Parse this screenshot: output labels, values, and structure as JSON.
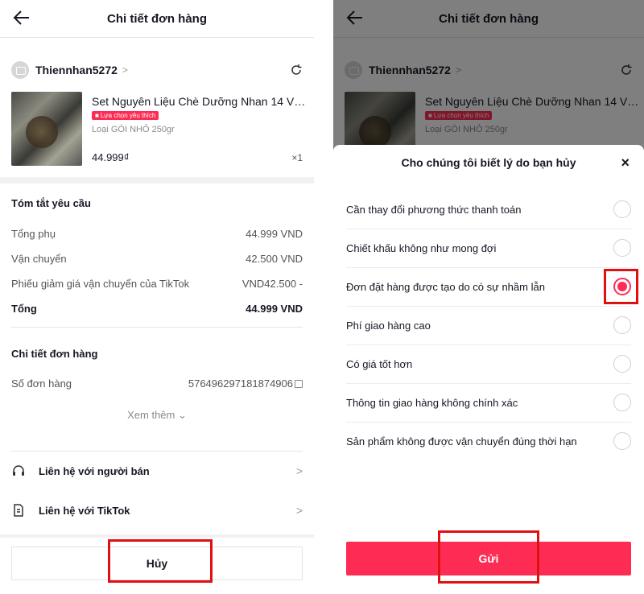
{
  "header": {
    "title": "Chi tiết đơn hàng"
  },
  "shop": {
    "name": "Thiennhan5272"
  },
  "product": {
    "name": "Set Nguyên Liệu Chè Dưỡng Nhan 14 Vị...",
    "badge": "Lựa chọn yêu thích",
    "variant": "Loại GÓI NHỎ 250gr",
    "price": "44.999₫",
    "qty": "×1"
  },
  "summary": {
    "title": "Tóm tắt yêu cầu",
    "rows": [
      {
        "label": "Tổng phụ",
        "value": "44.999 VND"
      },
      {
        "label": "Vận chuyển",
        "value": "42.500 VND"
      },
      {
        "label": "Phiếu giảm giá vận chuyển của TikTok",
        "value": "VND42.500 -"
      },
      {
        "label": "Tổng",
        "value": "44.999 VND"
      }
    ]
  },
  "details": {
    "title": "Chi tiết đơn hàng",
    "order_label": "Số đơn hàng",
    "order_number": "576496297181874906",
    "more": "Xem thêm ⌄"
  },
  "links": {
    "seller": "Liên hệ với người bán",
    "tiktok": "Liên hệ với TikTok"
  },
  "cancel_button": "Hủy",
  "modal": {
    "title": "Cho chúng tôi biết lý do bạn hủy",
    "close": "×",
    "options": [
      {
        "label": "Cần thay đổi phương thức thanh toán",
        "selected": false
      },
      {
        "label": "Chiết khấu không như mong đợi",
        "selected": false
      },
      {
        "label": "Đơn đặt hàng được tạo do có sự nhầm lẫn",
        "selected": true
      },
      {
        "label": "Phí giao hàng cao",
        "selected": false
      },
      {
        "label": "Có giá tốt hơn",
        "selected": false
      },
      {
        "label": "Thông tin giao hàng không chính xác",
        "selected": false
      },
      {
        "label": "Sản phẩm không được vận chuyển đúng thời hạn",
        "selected": false
      }
    ],
    "submit": "Gửi"
  },
  "colors": {
    "accent": "#fe2c55",
    "highlight": "#e01010"
  }
}
